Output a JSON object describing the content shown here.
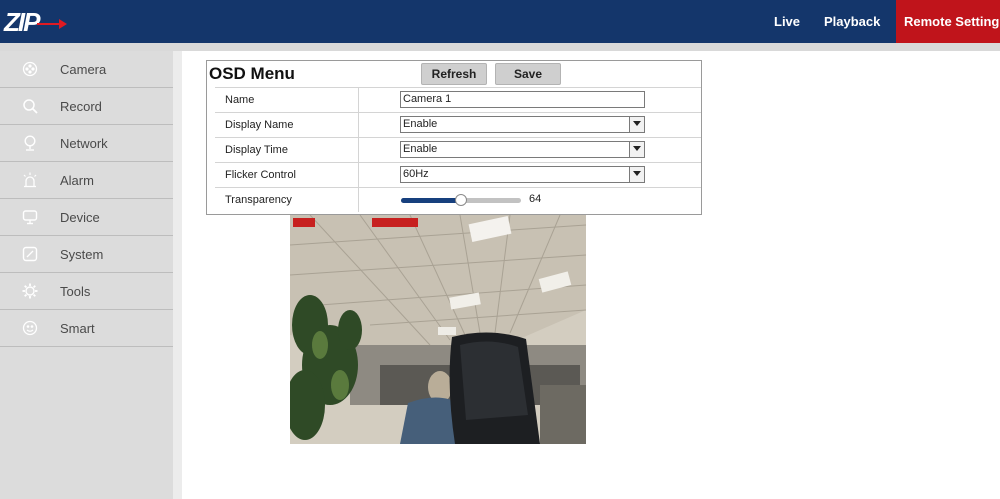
{
  "header": {
    "logo_text": "ZIP",
    "nav": [
      {
        "label": "Live"
      },
      {
        "label": "Playback"
      },
      {
        "label": "Remote Setting"
      }
    ],
    "active_nav_color": "#c0141b",
    "bar_color": "#14366b"
  },
  "sidebar": {
    "items": [
      {
        "label": "Camera",
        "icon": "camera-icon"
      },
      {
        "label": "Record",
        "icon": "search-icon"
      },
      {
        "label": "Network",
        "icon": "network-pin-icon"
      },
      {
        "label": "Alarm",
        "icon": "alarm-icon"
      },
      {
        "label": "Device",
        "icon": "device-icon"
      },
      {
        "label": "System",
        "icon": "system-icon"
      },
      {
        "label": "Tools",
        "icon": "gear-icon"
      },
      {
        "label": "Smart",
        "icon": "smart-icon"
      }
    ]
  },
  "osd": {
    "title": "OSD Menu",
    "refresh_label": "Refresh",
    "save_label": "Save",
    "rows": {
      "name": {
        "label": "Name",
        "value": "Camera 1"
      },
      "display_name": {
        "label": "Display Name",
        "value": "Enable"
      },
      "display_time": {
        "label": "Display Time",
        "value": "Enable"
      },
      "flicker_control": {
        "label": "Flicker Control",
        "value": "60Hz"
      },
      "transparency": {
        "label": "Transparency",
        "value": "64",
        "fraction": 0.5
      }
    }
  },
  "preview": {
    "icon": "camera-feed-image"
  }
}
